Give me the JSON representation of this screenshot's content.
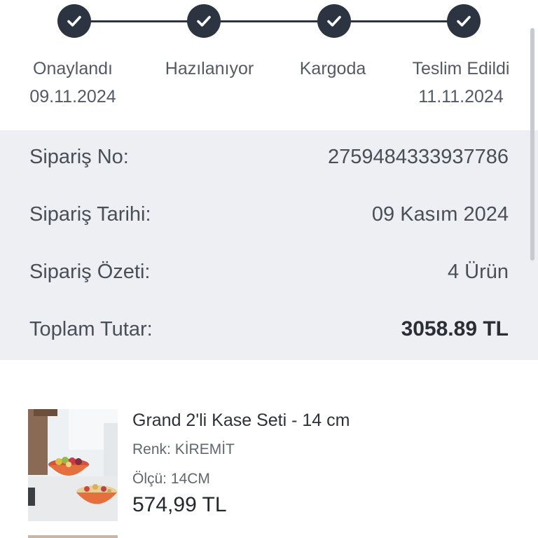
{
  "tracker": {
    "steps": [
      {
        "label": "Onaylandı",
        "date": "09.11.2024",
        "status": "completed"
      },
      {
        "label": "Hazılanıyor",
        "date": "",
        "status": "completed"
      },
      {
        "label": "Kargoda",
        "date": "",
        "status": "completed"
      },
      {
        "label": "Teslim Edildi",
        "date": "11.11.2024",
        "status": "completed"
      }
    ],
    "icon": "check-icon",
    "accent_color": "#2b3440"
  },
  "summary": {
    "order_no_label": "Sipariş No:",
    "order_no_value": "2759484333937786",
    "order_date_label": "Sipariş Tarihi:",
    "order_date_value": "09 Kasım 2024",
    "order_summary_label": "Sipariş Özeti:",
    "order_summary_value": "4 Ürün",
    "total_label": "Toplam Tutar:",
    "total_value": "3058.89 TL",
    "background_color": "#edeff3"
  },
  "products": [
    {
      "name": "Grand 2'li Kase Seti - 14 cm",
      "color": "Renk: KİREMİT",
      "size": "Ölçü: 14CM",
      "price": "574,99 TL",
      "image_icon": "bowl-set-photo"
    }
  ]
}
